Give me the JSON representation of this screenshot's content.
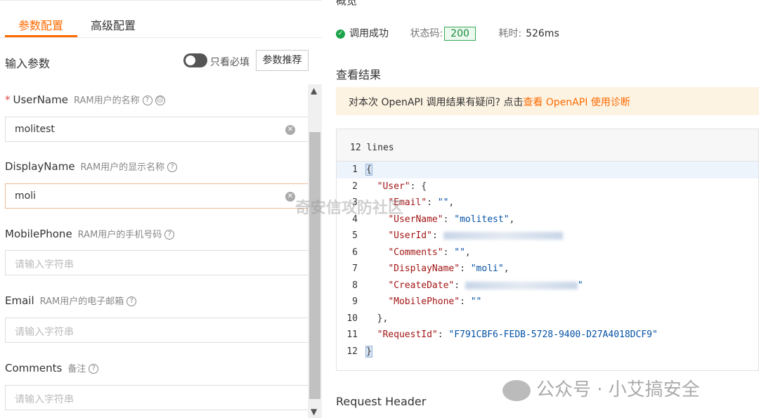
{
  "tabs": {
    "active": "参数配置",
    "inactive": "高级配置"
  },
  "input_section": {
    "title": "输入参数",
    "toggle_label": "只看必填",
    "recommend_button": "参数推荐"
  },
  "params": [
    {
      "required": "*",
      "name": "UserName",
      "desc": "RAM用户的名称",
      "value": "molitest",
      "placeholder": ""
    },
    {
      "name": "DisplayName",
      "desc": "RAM用户的显示名称",
      "value": "moli",
      "placeholder": ""
    },
    {
      "name": "MobilePhone",
      "desc": "RAM用户的手机号码",
      "value": "",
      "placeholder": "请输入字符串"
    },
    {
      "name": "Email",
      "desc": "RAM用户的电子邮箱",
      "value": "",
      "placeholder": "请输入字符串"
    },
    {
      "name": "Comments",
      "desc": "备注",
      "value": "",
      "placeholder": "请输入字符串"
    }
  ],
  "overview": {
    "title": "概览",
    "status": "调用成功",
    "code_label": "状态码:",
    "code": "200",
    "time_label": "耗时:",
    "time": "526ms"
  },
  "result": {
    "title": "查看结果",
    "notice_text": "对本次 OpenAPI 调用结果有疑问? 点击",
    "notice_link": "查看 OpenAPI 使用诊断",
    "lines_count": "12 lines",
    "line_numbers": [
      "1",
      "2",
      "3",
      "4",
      "5",
      "6",
      "7",
      "8",
      "9",
      "10",
      "11",
      "12"
    ],
    "json": {
      "l1": "{",
      "l2_key": "\"User\"",
      "l2_rest": ": {",
      "l3_key": "\"Email\"",
      "l3_val": "\"\"",
      "l4_key": "\"UserName\"",
      "l4_val": "\"molitest\"",
      "l5_key": "\"UserId\"",
      "l6_key": "\"Comments\"",
      "l6_val": "\"\"",
      "l7_key": "\"DisplayName\"",
      "l7_val": "\"moli\"",
      "l8_key": "\"CreateDate\"",
      "l8_val_end": "\"",
      "l9_key": "\"MobilePhone\"",
      "l9_val": "\"\"",
      "l10": "},",
      "l11_key": "\"RequestId\"",
      "l11_val": "\"F791CBF6-FEDB-5728-9400-D27A4018DCF9\"",
      "l12": "}"
    }
  },
  "request_header": "Request Header",
  "watermarks": {
    "center": "奇安信攻防社区",
    "bottom": "公众号 · 小艾搞安全"
  },
  "colors": {
    "accent": "#ff6a00",
    "success": "#1aa34a"
  }
}
